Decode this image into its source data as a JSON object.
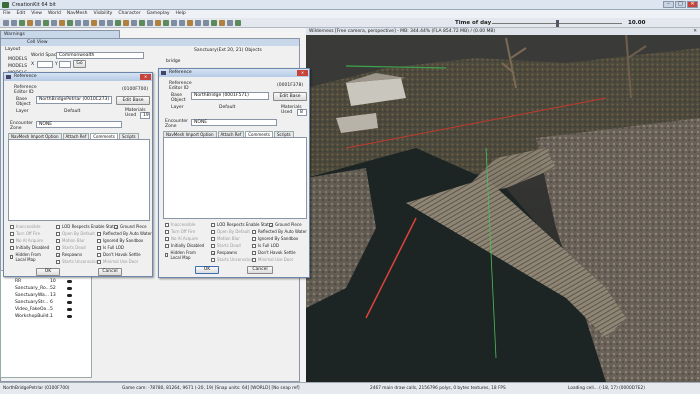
{
  "app": {
    "title": "CreationKit 64 bit"
  },
  "menu": [
    "File",
    "Edit",
    "View",
    "World",
    "NavMesh",
    "Visibility",
    "Character",
    "Gameplay",
    "Help"
  ],
  "toolbar": {
    "time_of_day_label": "Time of day",
    "time_of_day_value": "10.00"
  },
  "warnings": {
    "title": "Warnings"
  },
  "cell_view": {
    "title": "Cell View",
    "worldspace_label": "World Space",
    "worldspace_value": "Commonwealth",
    "x_label": "X",
    "y_label": "Y",
    "go_button": "Go",
    "layout_label": "Layout",
    "rows": [
      "MODELS",
      "MODELS",
      "MODELS"
    ],
    "objects_header": "Sanctuary(Ext 20, 21) Objects",
    "bridge_label": "bridge"
  },
  "list_rows": [
    {
      "name": "MiscDLayer",
      "count": "5"
    },
    {
      "name": "RR",
      "count": "10"
    },
    {
      "name": "Sanctuary_Ro...",
      "count": "52"
    },
    {
      "name": "SanctuaryWa...",
      "count": "13"
    },
    {
      "name": "SanctuaryStr...",
      "count": "6"
    },
    {
      "name": "Video_FakeOo...",
      "count": "5"
    },
    {
      "name": "WorkshopBuild...",
      "count": "1"
    }
  ],
  "ref1": {
    "title": "Reference",
    "ref_editor_id_label": "Reference Editor ID",
    "form_id": "(0100F700)",
    "base_label": "Base Object",
    "base_value": "NorthBridgePetrlar (0010C273)",
    "edit_base": "Edit Base",
    "layer_label": "Layer",
    "layer_value": "Default",
    "materials_used_label": "Materials Used",
    "materials_used_value": "19",
    "encounter_zone_label": "Encounter Zone",
    "encounter_zone_value": "NONE",
    "tabs": [
      "NavMesh Import Option",
      "Attach Ref",
      "Comments",
      "Scripts"
    ],
    "checks": [
      {
        "label": "Inaccessible",
        "checked": false,
        "gray": true
      },
      {
        "label": "LOD Respects Enable State",
        "checked": false,
        "gray": false
      },
      {
        "label": "Ground Piece",
        "checked": true,
        "gray": false
      },
      {
        "label": "Turn Off Fire",
        "checked": false,
        "gray": true
      },
      {
        "label": "Open By Default",
        "checked": false,
        "gray": true
      },
      {
        "label": "Reflected By Auto Water",
        "checked": false,
        "gray": false
      },
      {
        "label": "No AI Acquire",
        "checked": false,
        "gray": true
      },
      {
        "label": "Motion Blur",
        "checked": false,
        "gray": true
      },
      {
        "label": "Ignored By Sandbox",
        "checked": false,
        "gray": false
      },
      {
        "label": "Initially Disabled",
        "checked": false,
        "gray": false
      },
      {
        "label": "Starts Dead",
        "checked": false,
        "gray": true
      },
      {
        "label": "Is Full LOD",
        "checked": false,
        "gray": false
      },
      {
        "label": "Hidden From Local Map",
        "checked": false,
        "gray": false
      },
      {
        "label": "Respawns",
        "checked": true,
        "gray": false
      },
      {
        "label": "Don't Havok Settle",
        "checked": false,
        "gray": false
      },
      {
        "label": "Starts Unconscious",
        "checked": false,
        "gray": true
      },
      {
        "label": "Minimal Use Door",
        "checked": false,
        "gray": true
      }
    ],
    "ok": "OK",
    "cancel": "Cancel"
  },
  "ref2": {
    "title": "Reference",
    "ref_editor_id_label": "Reference Editor ID",
    "form_id": "(0001F378)",
    "base_label": "Base Object",
    "base_value": "NorthBridge (0001F571)",
    "edit_base": "Edit Base",
    "layer_label": "Layer",
    "layer_value": "Default",
    "materials_used_label": "Materials Used",
    "materials_used_value": "8",
    "encounter_zone_label": "Encounter Zone",
    "encounter_zone_value": "NONE",
    "tabs": [
      "NavMesh Import Option",
      "Attach Ref",
      "Comments",
      "Scripts"
    ],
    "ok": "OK",
    "cancel": "Cancel"
  },
  "viewport": {
    "title": "Wilderness [Free camera, perspective] - MB: 344.44% (FLA 854.72 MB) / (0.00 MB)"
  },
  "status": {
    "left": "NorthBridgePetrlar (0100F700)",
    "cam": "Game cam: -78780, 81264, 9671 (-20, 19) [Snap units: 64] [WORLD] [No snap ref]",
    "stats": "2467 main draw calls, 2156796 polys, 0 bytes textures, 18 FPS",
    "loading": "Loading cell... (-18, 17) (0000D7E2)"
  }
}
